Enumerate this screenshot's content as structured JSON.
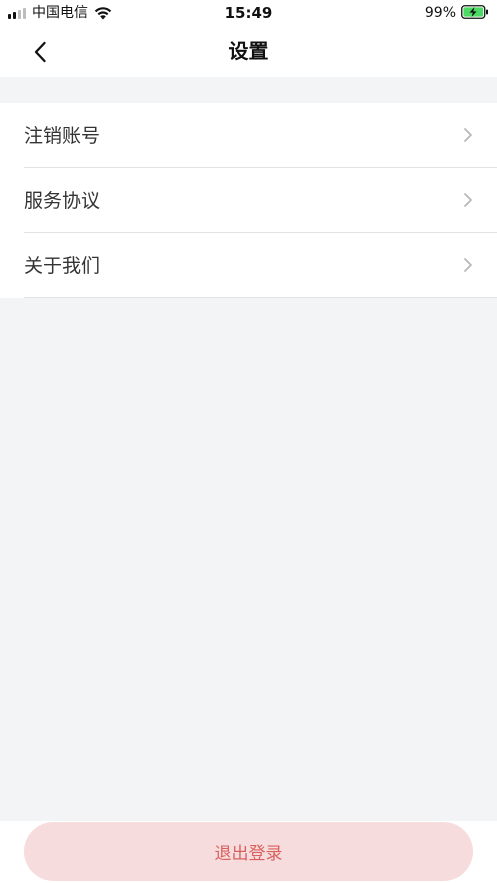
{
  "status_bar": {
    "carrier": "中国电信",
    "time": "15:49",
    "battery": "99%"
  },
  "nav": {
    "title": "设置",
    "back_icon": "chevron-left-icon"
  },
  "settings": {
    "items": [
      {
        "label": "注销账号"
      },
      {
        "label": "服务协议"
      },
      {
        "label": "关于我们"
      }
    ]
  },
  "footer": {
    "logout_label": "退出登录",
    "logout_bg": "#f7dcdd",
    "logout_text_color": "#d8615e"
  }
}
